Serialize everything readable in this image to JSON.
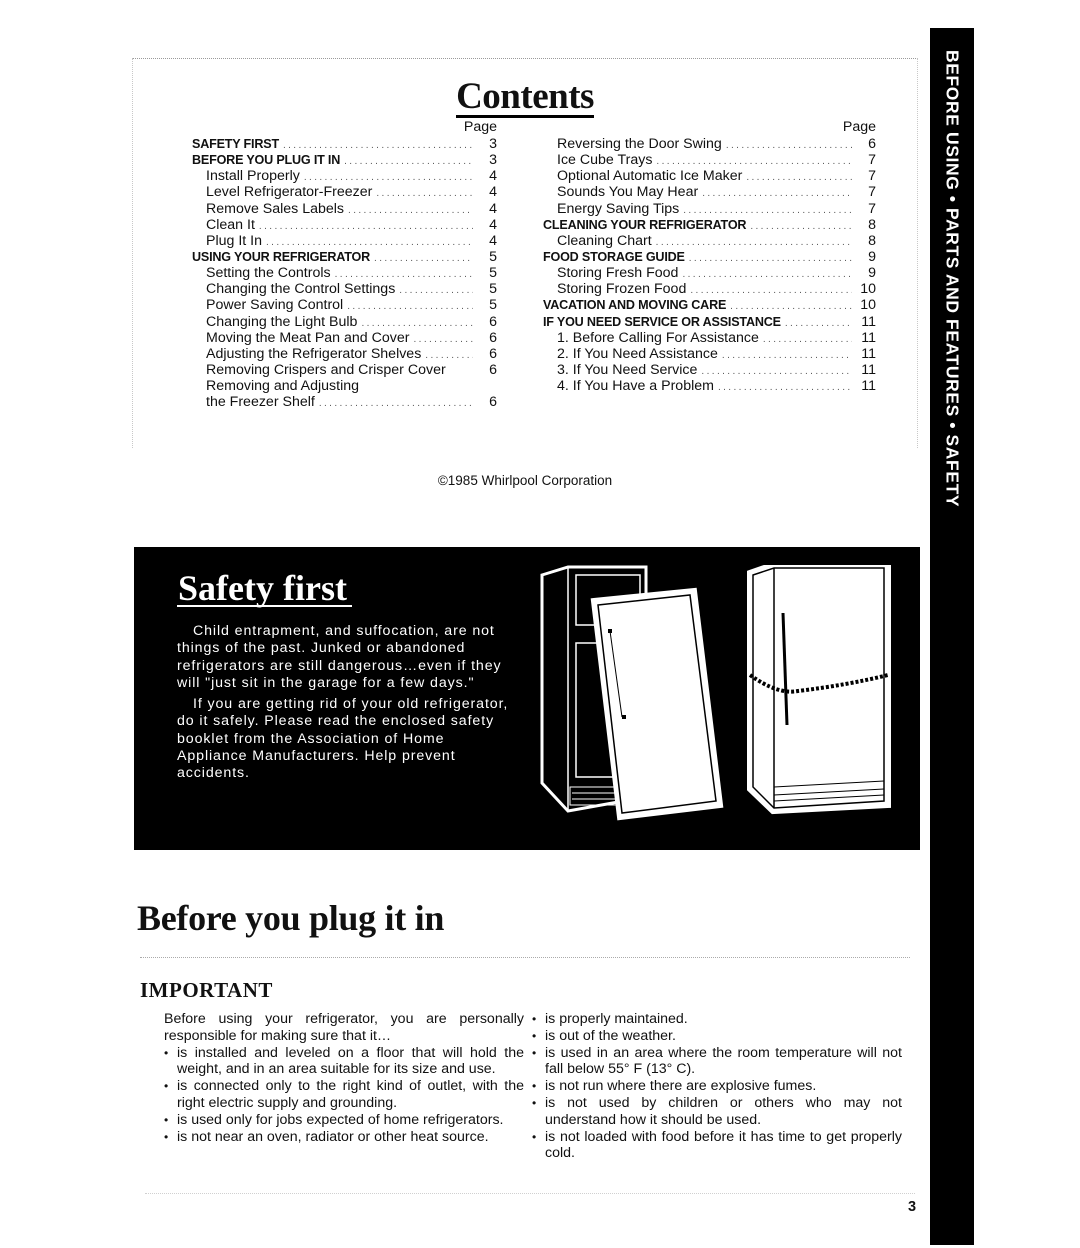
{
  "side_tab": {
    "text": "BEFORE USING • PARTS AND FEATURES • SAFETY"
  },
  "contents": {
    "title": "Contents",
    "page_header": "Page",
    "left_column": [
      {
        "label": "SAFETY FIRST",
        "page": "3",
        "style": "bold"
      },
      {
        "label": "BEFORE YOU PLUG IT IN",
        "page": "3",
        "style": "bold"
      },
      {
        "label": "Install Properly",
        "page": "4",
        "style": "sub"
      },
      {
        "label": "Level Refrigerator-Freezer",
        "page": "4",
        "style": "sub"
      },
      {
        "label": "Remove Sales Labels",
        "page": "4",
        "style": "sub"
      },
      {
        "label": "Clean It",
        "page": "4",
        "style": "sub"
      },
      {
        "label": "Plug It In",
        "page": "4",
        "style": "sub"
      },
      {
        "label": "USING YOUR REFRIGERATOR",
        "page": "5",
        "style": "bold"
      },
      {
        "label": "Setting the Controls",
        "page": "5",
        "style": "sub"
      },
      {
        "label": "Changing the Control Settings",
        "page": "5",
        "style": "sub"
      },
      {
        "label": "Power Saving Control",
        "page": "5",
        "style": "sub"
      },
      {
        "label": "Changing the Light Bulb",
        "page": "6",
        "style": "sub"
      },
      {
        "label": "Moving the Meat Pan and Cover",
        "page": "6",
        "style": "sub"
      },
      {
        "label": "Adjusting the Refrigerator Shelves",
        "page": "6",
        "style": "sub"
      },
      {
        "label": "Removing Crispers and Crisper Cover",
        "page": "6",
        "style": "sub-nodots"
      },
      {
        "label": "Removing  and  Adjusting",
        "page": "",
        "style": "sub-nodots"
      },
      {
        "label": "the Freezer Shelf",
        "page": "6",
        "style": "sub"
      }
    ],
    "right_column": [
      {
        "label": "Reversing the Door Swing",
        "page": "6",
        "style": "sub"
      },
      {
        "label": "Ice Cube Trays",
        "page": "7",
        "style": "sub"
      },
      {
        "label": "Optional Automatic Ice Maker",
        "page": "7",
        "style": "sub"
      },
      {
        "label": "Sounds You May Hear",
        "page": "7",
        "style": "sub"
      },
      {
        "label": "Energy Saving Tips",
        "page": "7",
        "style": "sub"
      },
      {
        "label": "CLEANING YOUR REFRIGERATOR",
        "page": "8",
        "style": "bold"
      },
      {
        "label": "Cleaning Chart",
        "page": "8",
        "style": "sub"
      },
      {
        "label": "FOOD STORAGE GUIDE",
        "page": "9",
        "style": "bold"
      },
      {
        "label": "Storing Fresh Food",
        "page": "9",
        "style": "sub"
      },
      {
        "label": "Storing Frozen Food",
        "page": "10",
        "style": "sub"
      },
      {
        "label": "VACATION AND MOVING CARE",
        "page": "10",
        "style": "bold"
      },
      {
        "label": "IF YOU NEED SERVICE OR ASSISTANCE",
        "page": "11",
        "style": "bold"
      },
      {
        "label": "1. Before Calling For Assistance",
        "page": "11",
        "style": "sub"
      },
      {
        "label": "2. If You Need Assistance",
        "page": "11",
        "style": "sub"
      },
      {
        "label": "3. If You Need Service",
        "page": "11",
        "style": "sub"
      },
      {
        "label": "4. If You Have a Problem",
        "page": "11",
        "style": "sub"
      }
    ],
    "copyright": "©1985 Whirlpool Corporation"
  },
  "safety": {
    "title": "Safety first",
    "paragraphs": [
      "Child entrapment, and suffocation, are not things of the past. Junked or abandoned refrigerators are still dangerous…even if they will \"just sit in the garage for a few days.\"",
      "If you are getting rid of your old refrigerator, do it safely. Please read the enclosed safety booklet from the Association of Home Appliance Manufacturers. Help prevent accidents."
    ],
    "illustration": "two-refrigerators-door-removed-and-chained-icon"
  },
  "before_plug": {
    "title": "Before you plug it in",
    "subtitle": "IMPORTANT",
    "intro": "Before using your refrigerator, you are personally responsible for making sure that it…",
    "left_bullets": [
      "is installed and leveled on a floor that will hold the weight, and in an area suitable for its size and use.",
      "is connected only to the right kind of outlet, with the right electric supply and grounding.",
      "is used only for jobs expected of home refrigerators.",
      "is not near an oven, radiator or other heat source."
    ],
    "right_bullets": [
      "is properly maintained.",
      "is out of the weather.",
      "is used in an area where the room temperature will not fall below 55° F (13° C).",
      "is not run where there are explosive fumes.",
      "is not used by children or others who may not understand how it should be used.",
      "is not loaded with food before it has time to get properly cold."
    ],
    "bullet_glyph": "•"
  },
  "page_number": "3"
}
